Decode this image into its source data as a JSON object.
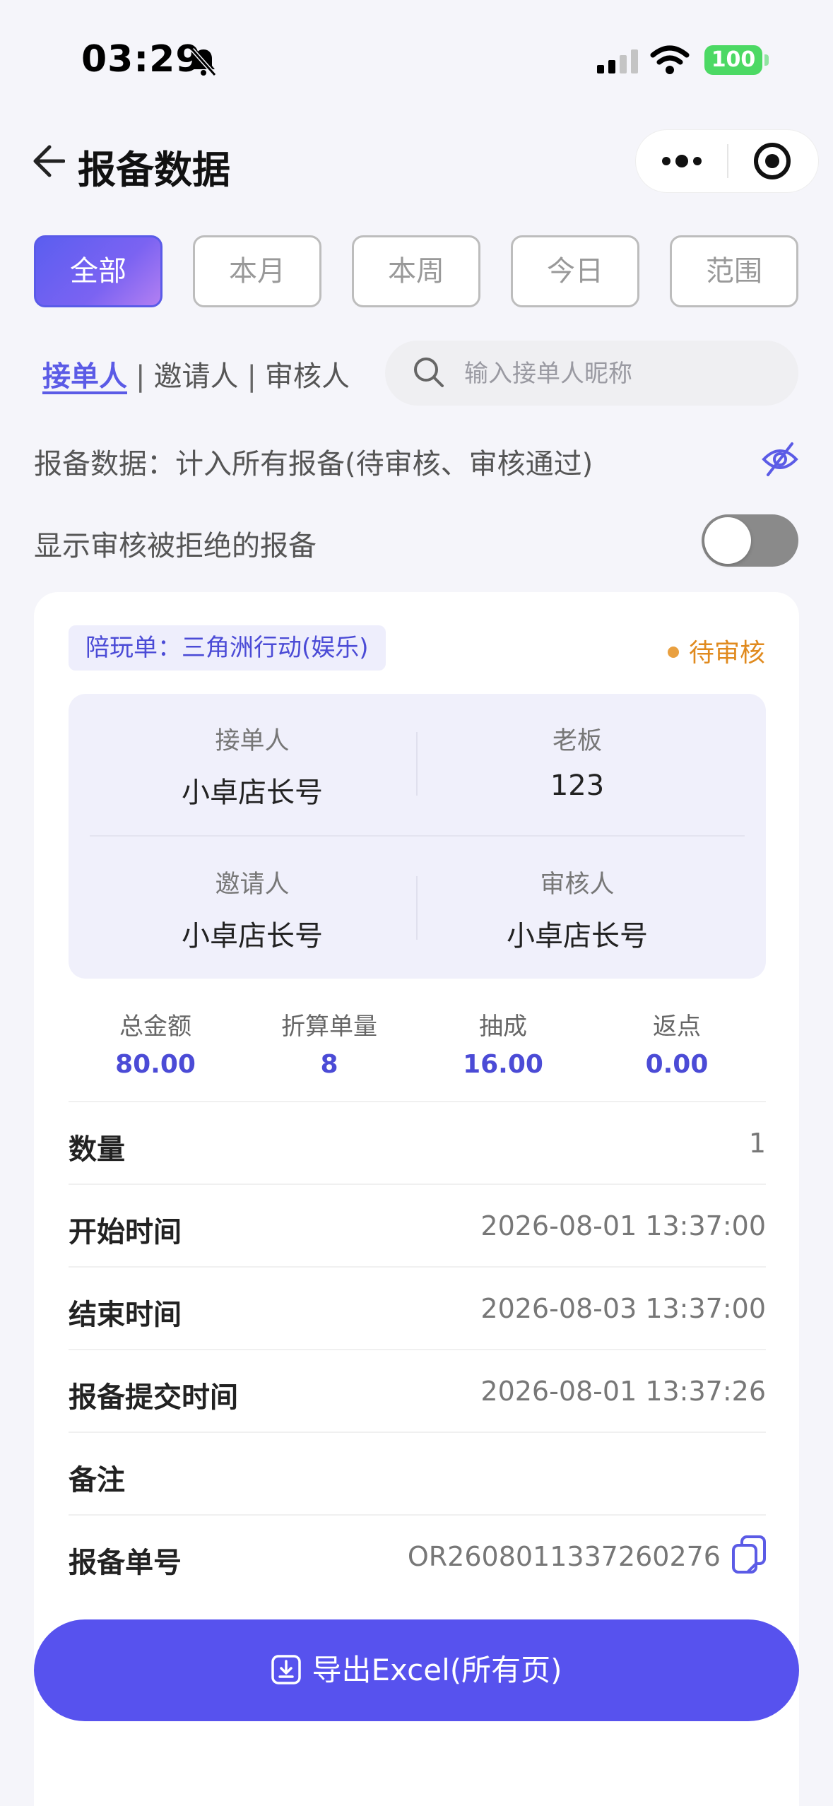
{
  "status_bar": {
    "time": "03:29",
    "battery": "100"
  },
  "nav": {
    "title": "报备数据"
  },
  "tabs": [
    "全部",
    "本月",
    "本周",
    "今日",
    "范围"
  ],
  "roles": {
    "selected": "接单人",
    "others": [
      "邀请人",
      "审核人"
    ]
  },
  "search": {
    "placeholder": "输入接单人昵称"
  },
  "info_text": "报备数据：计入所有报备(待审核、审核通过)",
  "show_rejected": {
    "label": "显示审核被拒绝的报备",
    "enabled": false
  },
  "order": {
    "type_tag": "陪玩单：三角洲行动(娱乐)",
    "status": "待审核",
    "people": [
      {
        "label": "接单人",
        "value": "小卓店长号"
      },
      {
        "label": "老板",
        "value": "123"
      },
      {
        "label": "邀请人",
        "value": "小卓店长号"
      },
      {
        "label": "审核人",
        "value": "小卓店长号"
      }
    ],
    "stats": [
      {
        "label": "总金额",
        "value": "80.00"
      },
      {
        "label": "折算单量",
        "value": "8"
      },
      {
        "label": "抽成",
        "value": "16.00"
      },
      {
        "label": "返点",
        "value": "0.00"
      }
    ],
    "rows": [
      {
        "label": "数量",
        "value": "1"
      },
      {
        "label": "开始时间",
        "value": "2026-08-01 13:37:00"
      },
      {
        "label": "结束时间",
        "value": "2026-08-03 13:37:00"
      },
      {
        "label": "报备提交时间",
        "value": "2026-08-01 13:37:26"
      },
      {
        "label": "备注",
        "value": ""
      },
      {
        "label": "报备单号",
        "value": "OR2608011337260276"
      }
    ]
  },
  "export_button": "导出Excel(所有页)",
  "colors": {
    "accent": "#5752ee",
    "status_pending": "#e08a1e",
    "battery": "#4cd964"
  }
}
